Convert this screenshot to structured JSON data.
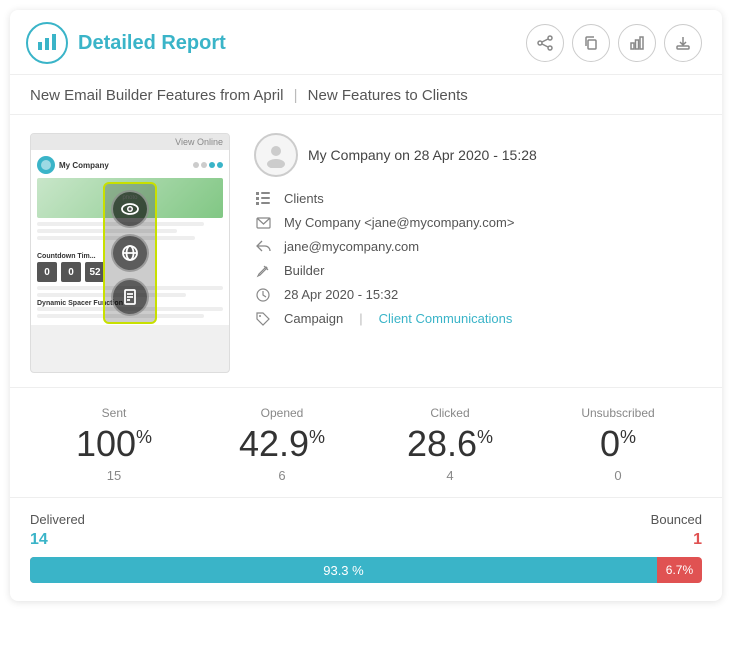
{
  "header": {
    "title": "Detailed Report",
    "logo_icon": "📊",
    "actions": [
      {
        "name": "share-button",
        "icon": "⤴",
        "label": "Share"
      },
      {
        "name": "copy-button",
        "icon": "⎘",
        "label": "Copy"
      },
      {
        "name": "chart-button",
        "icon": "📊",
        "label": "Chart"
      },
      {
        "name": "export-button",
        "icon": "📤",
        "label": "Export"
      }
    ]
  },
  "subtitle": {
    "part1": "New Email Builder Features from April",
    "separator": "|",
    "part2": "New Features to Clients"
  },
  "campaign": {
    "sender": "My Company on 28 Apr 2020 - 15:28",
    "list": "Clients",
    "from_email": "My Company <jane@mycompany.com>",
    "reply_to": "jane@mycompany.com",
    "type": "Builder",
    "scheduled": "28 Apr 2020 - 15:32",
    "campaign_label": "Campaign",
    "campaign_link": "Client Communications"
  },
  "preview": {
    "topbar": "View Online",
    "company_name": "My Company",
    "text_lines": 3,
    "countdown_label": "Countdown Tim...",
    "num1": "0",
    "num2": "0",
    "num3": "52"
  },
  "stats": [
    {
      "label": "Sent",
      "value": "100",
      "unit": "%",
      "count": "15"
    },
    {
      "label": "Opened",
      "value": "42.9",
      "unit": "%",
      "count": "6"
    },
    {
      "label": "Clicked",
      "value": "28.6",
      "unit": "%",
      "count": "4"
    },
    {
      "label": "Unsubscribed",
      "value": "0",
      "unit": "%",
      "count": "0"
    }
  ],
  "delivery": {
    "delivered_label": "Delivered",
    "bounced_label": "Bounced",
    "delivered_count": "14",
    "bounced_count": "1",
    "delivered_pct": 93.3,
    "bounced_pct": 6.7,
    "bar_text": "93.3 %",
    "bounce_text": "6.7%"
  },
  "colors": {
    "accent": "#3ab4c8",
    "bounced": "#e05252",
    "yellow_border": "#c8e000"
  }
}
